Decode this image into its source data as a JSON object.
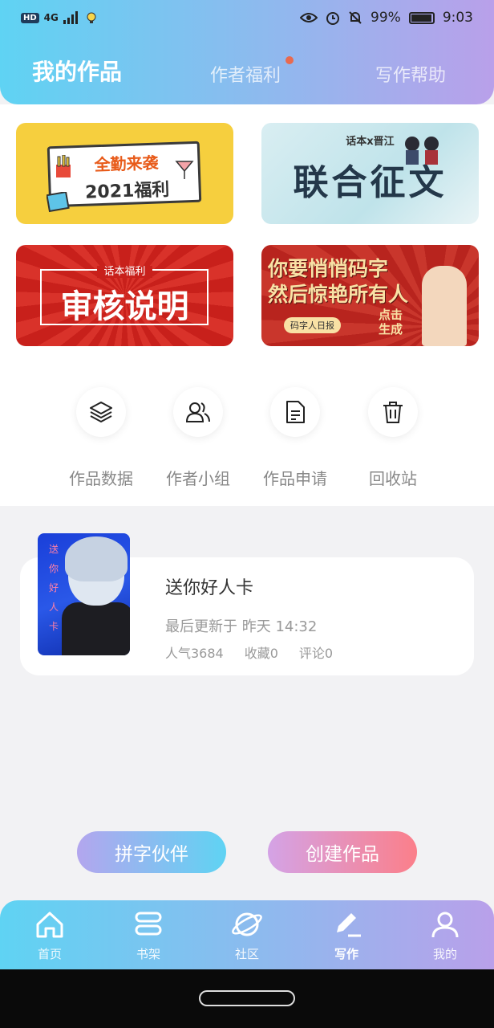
{
  "status_bar": {
    "hd": "HD",
    "network": "4G",
    "battery": "99%",
    "time": "9:03"
  },
  "tabs": [
    {
      "label": "我的作品",
      "active": true
    },
    {
      "label": "作者福利",
      "active": false,
      "has_dot": true
    },
    {
      "label": "写作帮助",
      "active": false
    }
  ],
  "banners": {
    "b1": {
      "line1": "全勤来袭",
      "line2": "2021福利"
    },
    "b2": {
      "top": "话本x晋江",
      "main": "联合征文"
    },
    "b3": {
      "small": "话本福利",
      "main": "审核说明"
    },
    "b4": {
      "line1": "你要悄悄码字",
      "line2": "然后惊艳所有人",
      "tag": "码字人日报",
      "click": "点击生成"
    }
  },
  "shortcuts": [
    {
      "label": "作品数据",
      "icon": "layers-icon"
    },
    {
      "label": "作者小组",
      "icon": "group-icon"
    },
    {
      "label": "作品申请",
      "icon": "document-icon"
    },
    {
      "label": "回收站",
      "icon": "trash-icon"
    }
  ],
  "work": {
    "cover_text": "送你好人卡",
    "title": "送你好人卡",
    "last_update": "最后更新于 昨天 14:32",
    "popularity": "人气3684",
    "favorites": "收藏0",
    "comments": "评论0"
  },
  "actions": {
    "partner": "拼字伙伴",
    "create": "创建作品"
  },
  "bottom_nav": [
    {
      "label": "首页",
      "icon": "home-icon"
    },
    {
      "label": "书架",
      "icon": "bookshelf-icon"
    },
    {
      "label": "社区",
      "icon": "planet-icon"
    },
    {
      "label": "写作",
      "icon": "pen-icon",
      "active": true
    },
    {
      "label": "我的",
      "icon": "profile-icon"
    }
  ],
  "colors": {
    "gradient_start": "#5fd3f3",
    "gradient_end": "#b9a0ea",
    "notification_dot": "#e86a4f",
    "create_button_end": "#fb7f8a"
  }
}
